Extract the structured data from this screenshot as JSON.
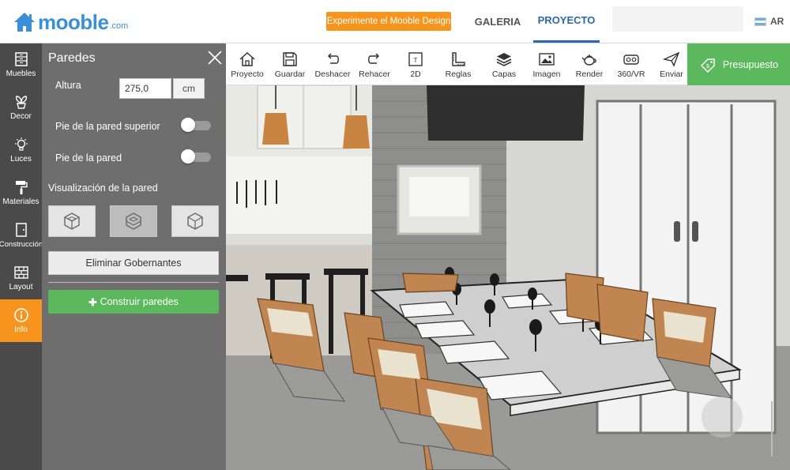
{
  "header": {
    "logo_text": "mooble",
    "logo_suffix": ".com",
    "cta_label": "Experimente el Mooble Design",
    "nav": [
      {
        "label": "GALERIA",
        "active": false
      },
      {
        "label": "PROYECTO",
        "active": true
      }
    ],
    "language": "AR",
    "flag_icon": "argentina-flag-icon"
  },
  "rail": {
    "items": [
      {
        "label": "Muebles",
        "icon": "dresser-icon"
      },
      {
        "label": "Decor",
        "icon": "plant-icon"
      },
      {
        "label": "Luces",
        "icon": "bulb-icon"
      },
      {
        "label": "Materiales",
        "icon": "paint-roller-icon"
      },
      {
        "label": "Construcción",
        "icon": "door-icon"
      },
      {
        "label": "Layout",
        "icon": "brick-icon"
      },
      {
        "label": "Info",
        "icon": "info-icon",
        "active": true
      }
    ]
  },
  "panel": {
    "title": "Paredes",
    "height_label": "Altura",
    "height_value": "275,0",
    "height_unit": "cm",
    "toggle_upper_label": "Pie de la pared superior",
    "toggle_lower_label": "Pie de la pared",
    "toggle_upper_on": false,
    "toggle_lower_on": false,
    "visualization_label": "Visualización de la pared",
    "view_modes": [
      "cube-full-icon",
      "cube-cut-icon",
      "cube-outline-icon"
    ],
    "delete_button": "Eliminar Gobernantes",
    "build_button": "Construir paredes",
    "build_icon": "plus-icon"
  },
  "toolbar": {
    "tools": [
      {
        "label": "Proyecto",
        "icon": "house-icon"
      },
      {
        "label": "Guardar",
        "icon": "save-icon"
      },
      {
        "label": "Deshacer",
        "icon": "undo-icon"
      },
      {
        "label": "Rehacer",
        "icon": "redo-icon"
      },
      {
        "label": "2D",
        "icon": "2d-icon"
      },
      {
        "label": "Reglas",
        "icon": "ruler-icon"
      },
      {
        "label": "Capas",
        "icon": "layers-icon"
      },
      {
        "label": "Imagen",
        "icon": "image-icon"
      },
      {
        "label": "Render",
        "icon": "teapot-icon"
      },
      {
        "label": "360/VR",
        "icon": "vr-icon"
      },
      {
        "label": "Enviar",
        "icon": "send-icon"
      }
    ],
    "budget_label": "Presupuesto",
    "budget_icon": "price-tag-icon"
  },
  "colors": {
    "accent_orange": "#f7941d",
    "accent_green": "#5cb85c",
    "brand_blue": "#3a8fd6",
    "rail_bg": "#4a4a4a",
    "panel_bg": "#6e6e6e"
  }
}
